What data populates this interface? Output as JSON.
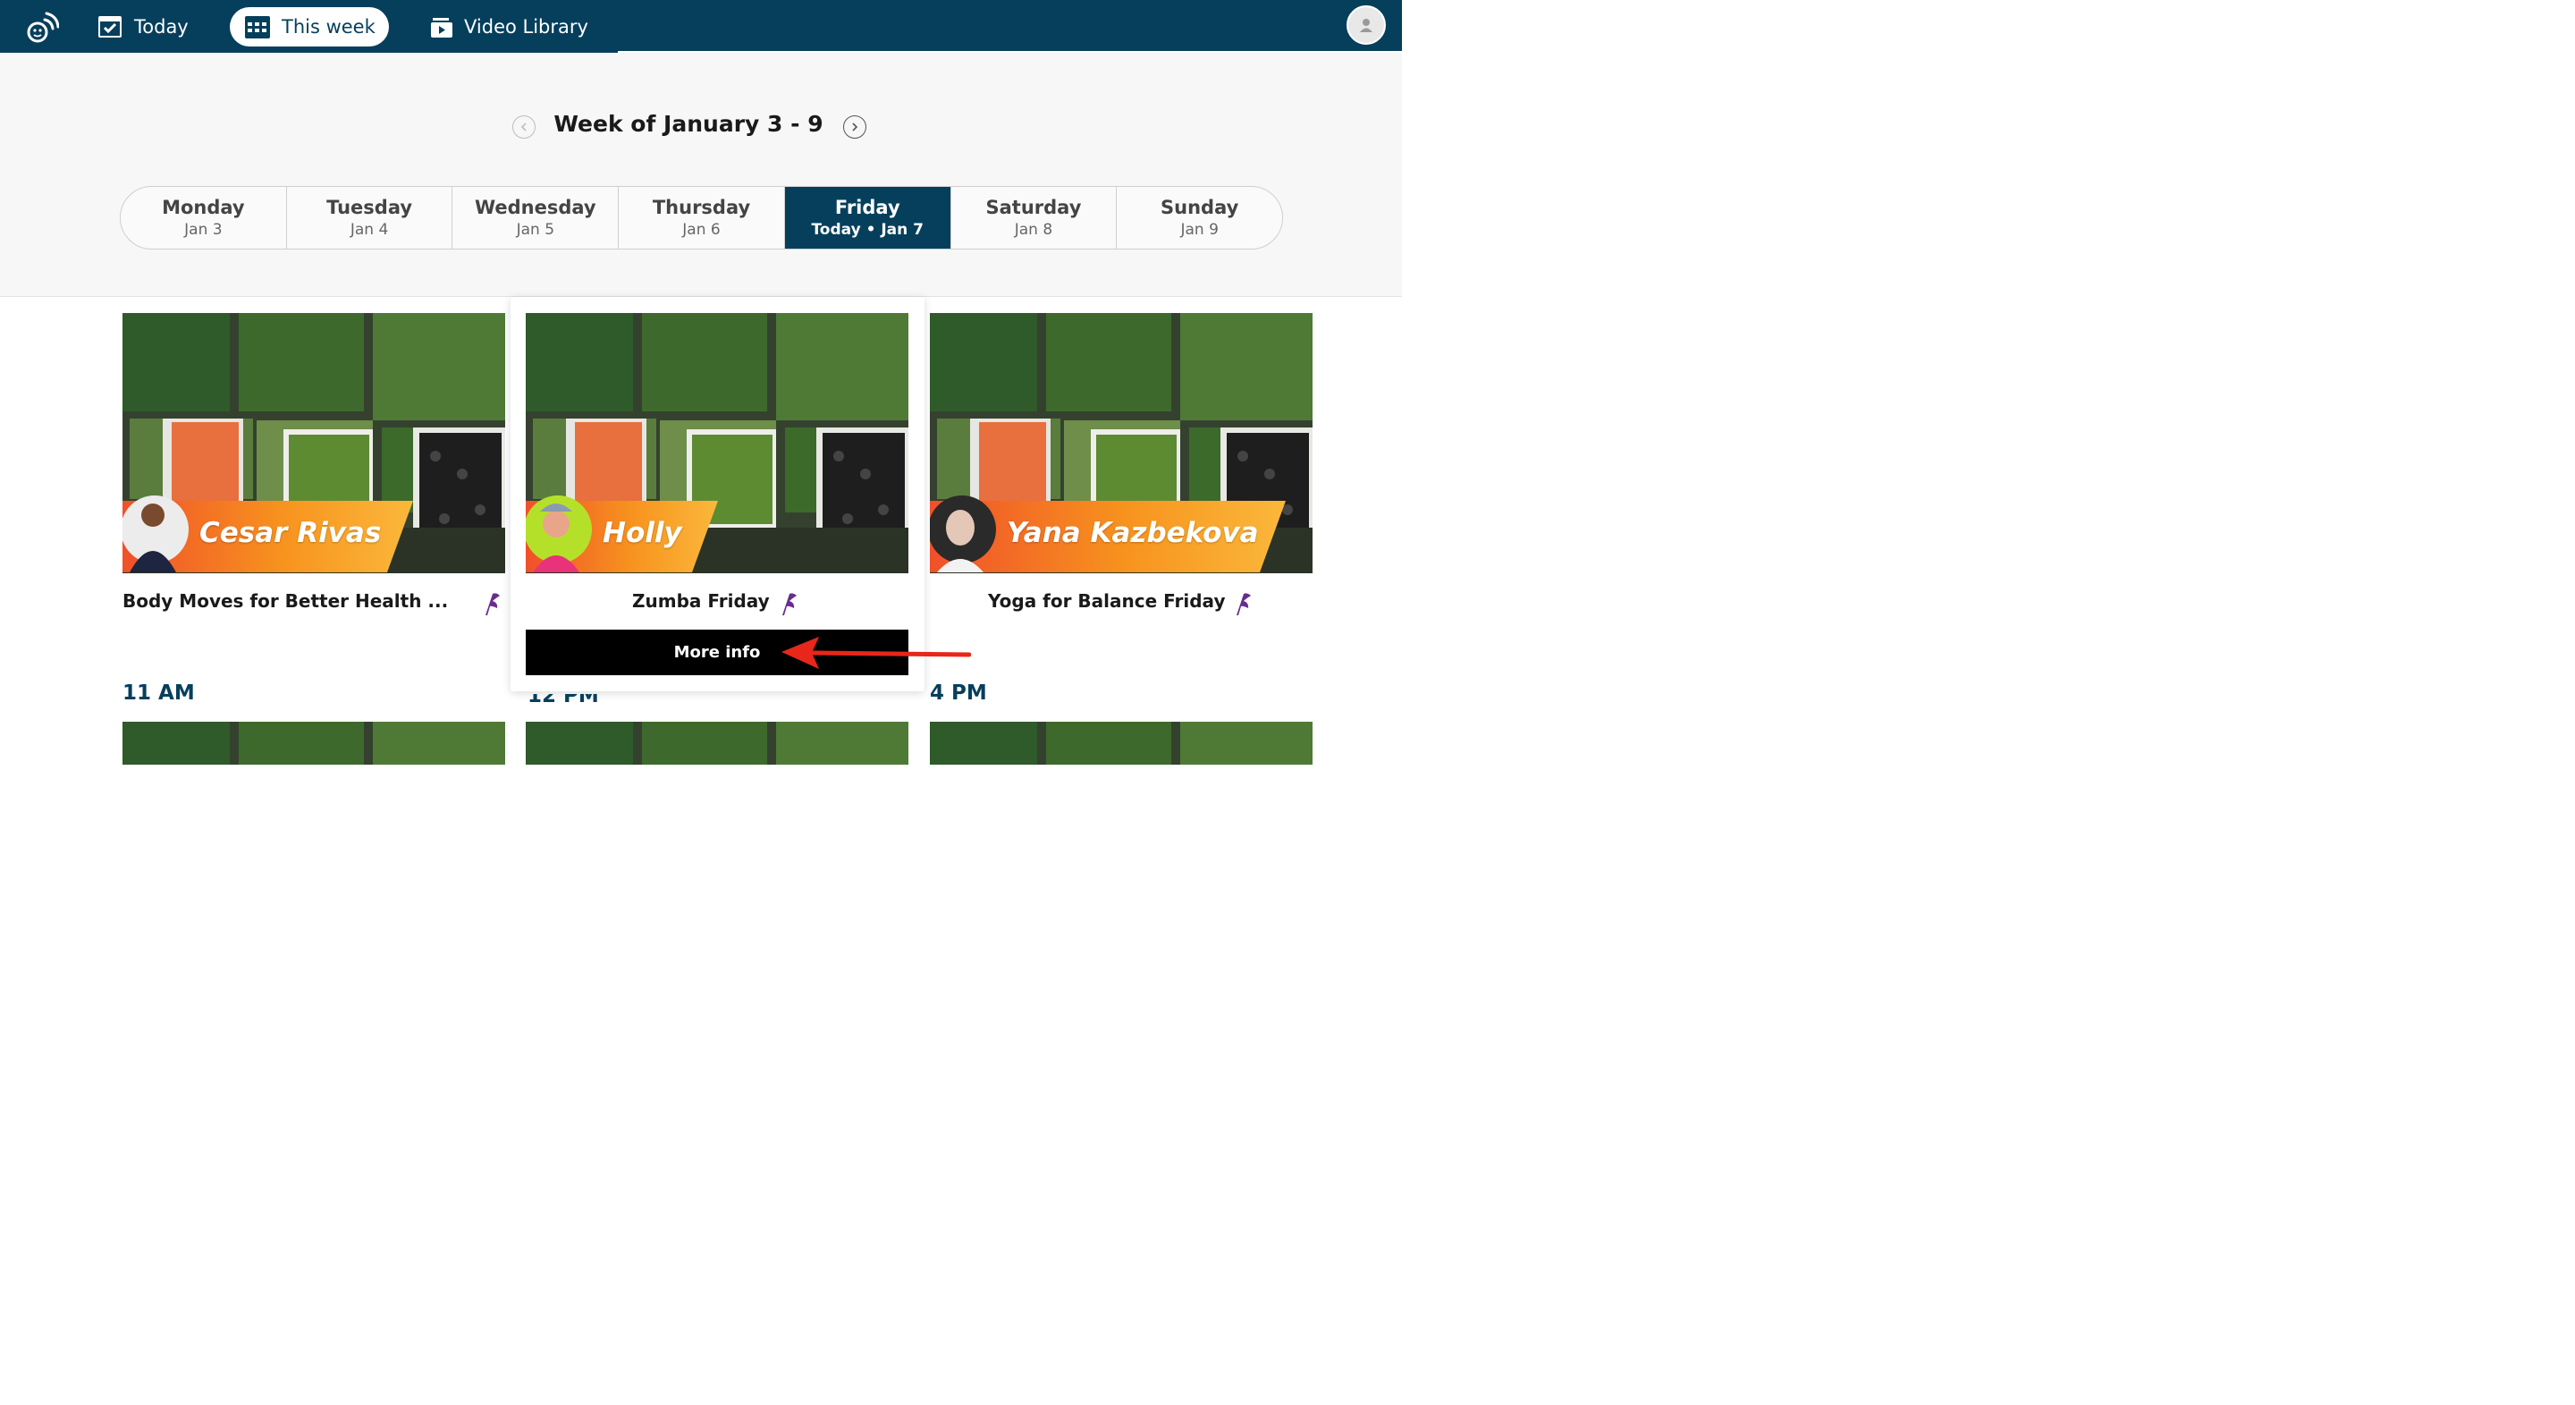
{
  "nav": {
    "today_label": "Today",
    "week_label": "This week",
    "library_label": "Video Library"
  },
  "week": {
    "title": "Week of January 3 - 9",
    "days": [
      {
        "name": "Monday",
        "date": "Jan 3"
      },
      {
        "name": "Tuesday",
        "date": "Jan 4"
      },
      {
        "name": "Wednesday",
        "date": "Jan 5"
      },
      {
        "name": "Thursday",
        "date": "Jan 6"
      },
      {
        "name": "Friday",
        "date": "Today • Jan 7"
      },
      {
        "name": "Saturday",
        "date": "Jan 8"
      },
      {
        "name": "Sunday",
        "date": "Jan 9"
      }
    ]
  },
  "classes": [
    {
      "host": "Cesar Rivas",
      "title": "Body Moves for Better Health ..."
    },
    {
      "host": "Holly",
      "title": "Zumba Friday",
      "button": "More info"
    },
    {
      "host": "Yana Kazbekova",
      "title": "Yoga for Balance Friday"
    }
  ],
  "times": [
    "11 AM",
    "12 PM",
    "4 PM"
  ],
  "colors": {
    "header": "#063f5c",
    "banner_start": "#f05a28",
    "banner_end": "#fbb03b",
    "flag": "#6a2c91",
    "arrow": "#e8261a"
  }
}
